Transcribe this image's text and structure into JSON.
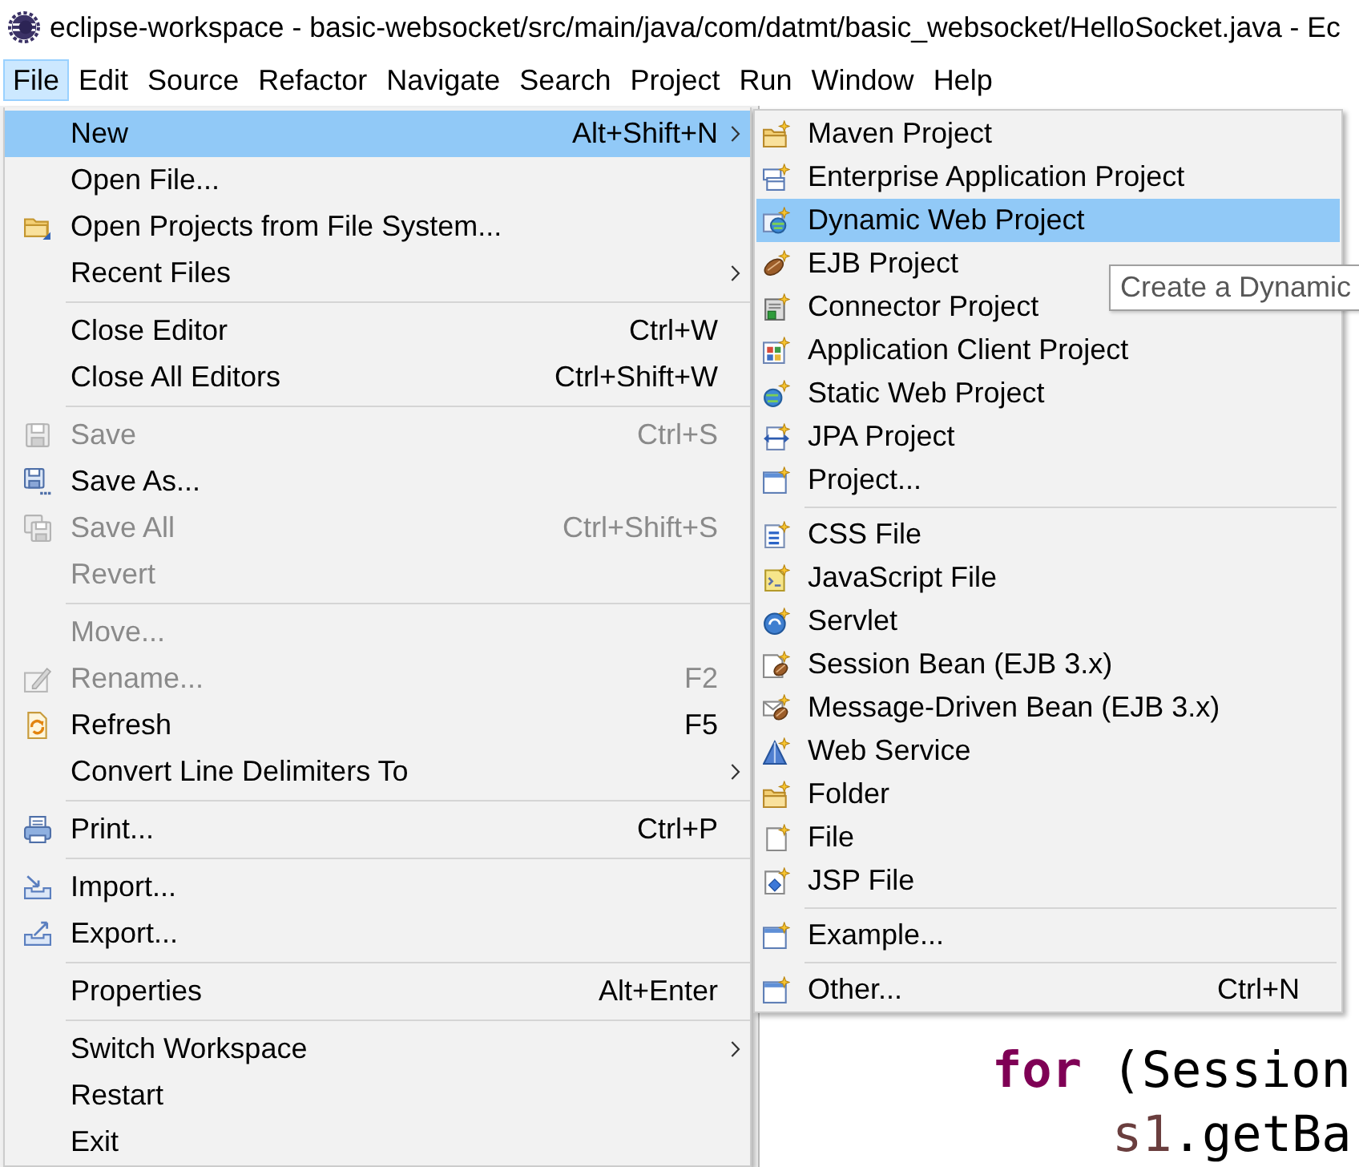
{
  "window": {
    "title": "eclipse-workspace - basic-websocket/src/main/java/com/datmt/basic_websocket/HelloSocket.java - Ec"
  },
  "menu_bar": [
    {
      "label": "File",
      "selected": true
    },
    {
      "label": "Edit",
      "selected": false
    },
    {
      "label": "Source",
      "selected": false
    },
    {
      "label": "Refactor",
      "selected": false
    },
    {
      "label": "Navigate",
      "selected": false
    },
    {
      "label": "Search",
      "selected": false
    },
    {
      "label": "Project",
      "selected": false
    },
    {
      "label": "Run",
      "selected": false
    },
    {
      "label": "Window",
      "selected": false
    },
    {
      "label": "Help",
      "selected": false
    }
  ],
  "file_menu": {
    "items": [
      {
        "kind": "item",
        "label": "New",
        "shortcut": "Alt+Shift+N",
        "submenu": true,
        "selected": true,
        "disabled": false
      },
      {
        "kind": "item",
        "label": "Open File...",
        "submenu": false,
        "selected": false,
        "disabled": false
      },
      {
        "kind": "item",
        "label": "Open Projects from File System...",
        "submenu": false,
        "selected": false,
        "disabled": false
      },
      {
        "kind": "item",
        "label": "Recent Files",
        "submenu": true,
        "selected": false,
        "disabled": false
      },
      {
        "kind": "separator"
      },
      {
        "kind": "item",
        "label": "Close Editor",
        "shortcut": "Ctrl+W",
        "submenu": false,
        "selected": false,
        "disabled": false
      },
      {
        "kind": "item",
        "label": "Close All Editors",
        "shortcut": "Ctrl+Shift+W",
        "submenu": false,
        "selected": false,
        "disabled": false
      },
      {
        "kind": "separator"
      },
      {
        "kind": "item",
        "label": "Save",
        "shortcut": "Ctrl+S",
        "submenu": false,
        "selected": false,
        "disabled": true
      },
      {
        "kind": "item",
        "label": "Save As...",
        "submenu": false,
        "selected": false,
        "disabled": false
      },
      {
        "kind": "item",
        "label": "Save All",
        "shortcut": "Ctrl+Shift+S",
        "submenu": false,
        "selected": false,
        "disabled": true
      },
      {
        "kind": "item",
        "label": "Revert",
        "submenu": false,
        "selected": false,
        "disabled": true
      },
      {
        "kind": "separator"
      },
      {
        "kind": "item",
        "label": "Move...",
        "submenu": false,
        "selected": false,
        "disabled": true
      },
      {
        "kind": "item",
        "label": "Rename...",
        "shortcut": "F2",
        "submenu": false,
        "selected": false,
        "disabled": true
      },
      {
        "kind": "item",
        "label": "Refresh",
        "shortcut": "F5",
        "submenu": false,
        "selected": false,
        "disabled": false
      },
      {
        "kind": "item",
        "label": "Convert Line Delimiters To",
        "submenu": true,
        "selected": false,
        "disabled": false
      },
      {
        "kind": "separator"
      },
      {
        "kind": "item",
        "label": "Print...",
        "shortcut": "Ctrl+P",
        "submenu": false,
        "selected": false,
        "disabled": false
      },
      {
        "kind": "separator"
      },
      {
        "kind": "item",
        "label": "Import...",
        "submenu": false,
        "selected": false,
        "disabled": false
      },
      {
        "kind": "item",
        "label": "Export...",
        "submenu": false,
        "selected": false,
        "disabled": false
      },
      {
        "kind": "separator"
      },
      {
        "kind": "item",
        "label": "Properties",
        "shortcut": "Alt+Enter",
        "submenu": false,
        "selected": false,
        "disabled": false
      },
      {
        "kind": "separator"
      },
      {
        "kind": "item",
        "label": "Switch Workspace",
        "submenu": true,
        "selected": false,
        "disabled": false
      },
      {
        "kind": "item",
        "label": "Restart",
        "submenu": false,
        "selected": false,
        "disabled": false
      },
      {
        "kind": "item",
        "label": "Exit",
        "submenu": false,
        "selected": false,
        "disabled": false
      }
    ]
  },
  "new_submenu": {
    "items": [
      {
        "kind": "item",
        "label": "Maven Project",
        "selected": false
      },
      {
        "kind": "item",
        "label": "Enterprise Application Project",
        "selected": false
      },
      {
        "kind": "item",
        "label": "Dynamic Web Project",
        "selected": true
      },
      {
        "kind": "item",
        "label": "EJB Project",
        "selected": false
      },
      {
        "kind": "item",
        "label": "Connector Project",
        "selected": false
      },
      {
        "kind": "item",
        "label": "Application Client Project",
        "selected": false
      },
      {
        "kind": "item",
        "label": "Static Web Project",
        "selected": false
      },
      {
        "kind": "item",
        "label": "JPA Project",
        "selected": false
      },
      {
        "kind": "item",
        "label": "Project...",
        "selected": false
      },
      {
        "kind": "separator"
      },
      {
        "kind": "item",
        "label": "CSS File",
        "selected": false
      },
      {
        "kind": "item",
        "label": "JavaScript File",
        "selected": false
      },
      {
        "kind": "item",
        "label": "Servlet",
        "selected": false
      },
      {
        "kind": "item",
        "label": "Session Bean (EJB 3.x)",
        "selected": false
      },
      {
        "kind": "item",
        "label": "Message-Driven Bean (EJB 3.x)",
        "selected": false
      },
      {
        "kind": "item",
        "label": "Web Service",
        "selected": false
      },
      {
        "kind": "item",
        "label": "Folder",
        "selected": false
      },
      {
        "kind": "item",
        "label": "File",
        "selected": false
      },
      {
        "kind": "item",
        "label": "JSP File",
        "selected": false
      },
      {
        "kind": "separator"
      },
      {
        "kind": "item",
        "label": "Example...",
        "selected": false
      },
      {
        "kind": "separator"
      },
      {
        "kind": "item",
        "label": "Other...",
        "shortcut": "Ctrl+N",
        "selected": false
      }
    ]
  },
  "tooltip": {
    "text": "Create a Dynamic"
  },
  "editor": {
    "lines": [
      {
        "tokens": [
          {
            "text": "for",
            "kind": "keyword"
          },
          {
            "text": " (Session",
            "kind": "plain"
          }
        ],
        "children": [
          {
            "tokens": [
              {
                "text": "s1",
                "kind": "variable"
              },
              {
                "text": ".getBa",
                "kind": "plain"
              }
            ]
          }
        ]
      }
    ]
  }
}
